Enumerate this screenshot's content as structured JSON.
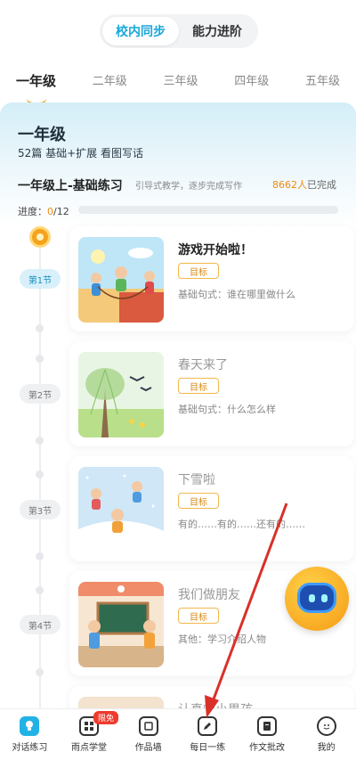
{
  "segment": {
    "options": [
      "校内同步",
      "能力进阶"
    ],
    "active": 0
  },
  "grades": [
    "一年级",
    "二年级",
    "三年级",
    "四年级",
    "五年级"
  ],
  "hero": {
    "title": "一年级",
    "subtitle": "52篇 基础+扩展 看图写话"
  },
  "course": {
    "title": "一年级上-基础练习",
    "desc": "引导式教学，逐步完成写作",
    "count_num": "8662人",
    "count_suffix": "已完成"
  },
  "progress": {
    "label": "进度：",
    "done": "0",
    "total": "/12",
    "fraction": 0.0
  },
  "lessons": [
    {
      "section": "第1节",
      "title": "游戏开始啦！",
      "tag": "目标",
      "pattern": "基础句式：谁在哪里做什么"
    },
    {
      "section": "第2节",
      "title": "春天来了",
      "tag": "目标",
      "pattern": "基础句式：什么怎么样"
    },
    {
      "section": "第3节",
      "title": "下雪啦",
      "tag": "目标",
      "pattern": "有的……有的……还有的……"
    },
    {
      "section": "第4节",
      "title": "我们做朋友",
      "tag": "目标",
      "pattern": "其他：学习介绍人物"
    },
    {
      "title": "认真的小男孩"
    }
  ],
  "nav": [
    {
      "label": "对话练习",
      "icon": "chat-bulb-icon"
    },
    {
      "label": "雨点学堂",
      "icon": "grid-icon",
      "badge": "限免"
    },
    {
      "label": "作品墙",
      "icon": "gallery-icon"
    },
    {
      "label": "每日一练",
      "icon": "pencil-icon"
    },
    {
      "label": "作文批改",
      "icon": "document-icon"
    },
    {
      "label": "我的",
      "icon": "smile-icon"
    }
  ],
  "colors": {
    "accent": "#1aa6d9",
    "orange": "#f7a21b",
    "annotation": "#d9302a"
  }
}
